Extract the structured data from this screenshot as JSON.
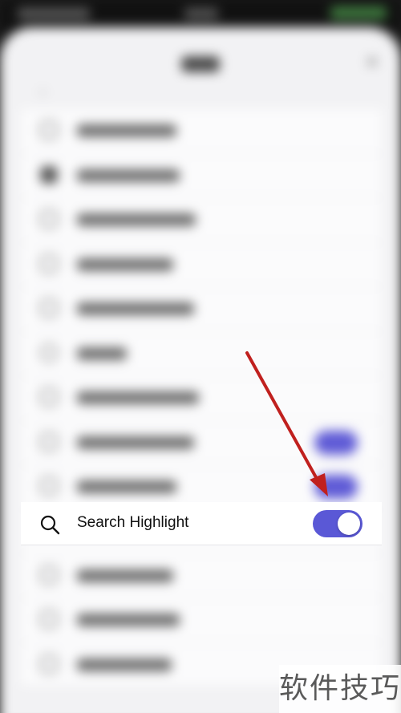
{
  "highlighted_setting": {
    "label": "Search Highlight",
    "icon": "search-icon",
    "toggle_on": true
  },
  "accent_color": "#5a58d6",
  "arrow_color": "#c0201e",
  "watermark": "软件技巧"
}
